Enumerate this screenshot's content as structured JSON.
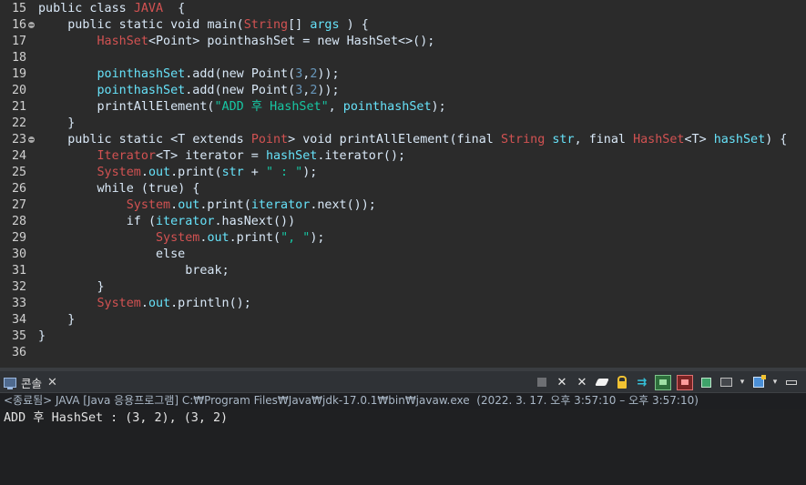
{
  "editor": {
    "lines": [
      {
        "n": "15",
        "fold": false,
        "segs": [
          [
            "kw",
            "public class "
          ],
          [
            "cls",
            "JAVA"
          ],
          [
            "pl",
            "  {"
          ]
        ]
      },
      {
        "n": "16",
        "fold": true,
        "segs": [
          [
            "pl",
            "    "
          ],
          [
            "kw",
            "public static void "
          ],
          [
            "pl",
            "main("
          ],
          [
            "cls",
            "String"
          ],
          [
            "pl",
            "[] "
          ],
          [
            "fld",
            "args"
          ],
          [
            "pl",
            " ) {"
          ]
        ]
      },
      {
        "n": "17",
        "fold": false,
        "segs": [
          [
            "pl",
            "        "
          ],
          [
            "cls",
            "HashSet"
          ],
          [
            "pl",
            "<Point> pointhashSet = "
          ],
          [
            "kw",
            "new "
          ],
          [
            "pl",
            "HashSet<>();"
          ]
        ]
      },
      {
        "n": "18",
        "fold": false,
        "segs": []
      },
      {
        "n": "19",
        "fold": false,
        "segs": [
          [
            "pl",
            "        "
          ],
          [
            "fld",
            "pointhashSet"
          ],
          [
            "pl",
            ".add("
          ],
          [
            "kw",
            "new "
          ],
          [
            "pl",
            "Point("
          ],
          [
            "num",
            "3"
          ],
          [
            "pl",
            ","
          ],
          [
            "num",
            "2"
          ],
          [
            "pl",
            "));"
          ]
        ]
      },
      {
        "n": "20",
        "fold": false,
        "segs": [
          [
            "pl",
            "        "
          ],
          [
            "fld",
            "pointhashSet"
          ],
          [
            "pl",
            ".add("
          ],
          [
            "kw",
            "new "
          ],
          [
            "pl",
            "Point("
          ],
          [
            "num",
            "3"
          ],
          [
            "pl",
            ","
          ],
          [
            "num",
            "2"
          ],
          [
            "pl",
            "));"
          ]
        ]
      },
      {
        "n": "21",
        "fold": false,
        "segs": [
          [
            "pl",
            "        printAllElement("
          ],
          [
            "str",
            "\"ADD 후 HashSet\""
          ],
          [
            "pl",
            ", "
          ],
          [
            "fld",
            "pointhashSet"
          ],
          [
            "pl",
            ");"
          ]
        ]
      },
      {
        "n": "22",
        "fold": false,
        "segs": [
          [
            "pl",
            "    }"
          ]
        ]
      },
      {
        "n": "23",
        "fold": true,
        "segs": [
          [
            "pl",
            "    "
          ],
          [
            "kw",
            "public static "
          ],
          [
            "pl",
            "<T "
          ],
          [
            "kw",
            "extends "
          ],
          [
            "cls",
            "Point"
          ],
          [
            "pl",
            "> "
          ],
          [
            "kw",
            "void "
          ],
          [
            "pl",
            "printAllElement("
          ],
          [
            "kw",
            "final "
          ],
          [
            "cls",
            "String"
          ],
          [
            "pl",
            " "
          ],
          [
            "fld",
            "str"
          ],
          [
            "pl",
            ", "
          ],
          [
            "kw",
            "final "
          ],
          [
            "cls",
            "HashSet"
          ],
          [
            "pl",
            "<T> "
          ],
          [
            "fld",
            "hashSet"
          ],
          [
            "pl",
            ") {"
          ]
        ]
      },
      {
        "n": "24",
        "fold": false,
        "segs": [
          [
            "pl",
            "        "
          ],
          [
            "cls",
            "Iterator"
          ],
          [
            "pl",
            "<T> iterator = "
          ],
          [
            "fld",
            "hashSet"
          ],
          [
            "pl",
            ".iterator();"
          ]
        ]
      },
      {
        "n": "25",
        "fold": false,
        "segs": [
          [
            "pl",
            "        "
          ],
          [
            "cls",
            "System"
          ],
          [
            "pl",
            "."
          ],
          [
            "fld",
            "out"
          ],
          [
            "pl",
            ".print("
          ],
          [
            "fld",
            "str"
          ],
          [
            "pl",
            " + "
          ],
          [
            "str",
            "\" : \""
          ],
          [
            "pl",
            ");"
          ]
        ]
      },
      {
        "n": "26",
        "fold": false,
        "segs": [
          [
            "pl",
            "        "
          ],
          [
            "kw",
            "while "
          ],
          [
            "pl",
            "("
          ],
          [
            "kw",
            "true"
          ],
          [
            "pl",
            ") {"
          ]
        ]
      },
      {
        "n": "27",
        "fold": false,
        "segs": [
          [
            "pl",
            "            "
          ],
          [
            "cls",
            "System"
          ],
          [
            "pl",
            "."
          ],
          [
            "fld",
            "out"
          ],
          [
            "pl",
            ".print("
          ],
          [
            "fld",
            "iterator"
          ],
          [
            "pl",
            ".next());"
          ]
        ]
      },
      {
        "n": "28",
        "fold": false,
        "segs": [
          [
            "pl",
            "            "
          ],
          [
            "kw",
            "if "
          ],
          [
            "pl",
            "("
          ],
          [
            "fld",
            "iterator"
          ],
          [
            "pl",
            ".hasNext())"
          ]
        ]
      },
      {
        "n": "29",
        "fold": false,
        "segs": [
          [
            "pl",
            "                "
          ],
          [
            "cls",
            "System"
          ],
          [
            "pl",
            "."
          ],
          [
            "fld",
            "out"
          ],
          [
            "pl",
            ".print("
          ],
          [
            "str",
            "\", \""
          ],
          [
            "pl",
            ");"
          ]
        ]
      },
      {
        "n": "30",
        "fold": false,
        "segs": [
          [
            "pl",
            "                "
          ],
          [
            "kw",
            "else"
          ]
        ]
      },
      {
        "n": "31",
        "fold": false,
        "segs": [
          [
            "pl",
            "                    "
          ],
          [
            "kw",
            "break"
          ],
          [
            "pl",
            ";"
          ]
        ]
      },
      {
        "n": "32",
        "fold": false,
        "segs": [
          [
            "pl",
            "        }"
          ]
        ]
      },
      {
        "n": "33",
        "fold": false,
        "segs": [
          [
            "pl",
            "        "
          ],
          [
            "cls",
            "System"
          ],
          [
            "pl",
            "."
          ],
          [
            "fld",
            "out"
          ],
          [
            "pl",
            ".println();"
          ]
        ]
      },
      {
        "n": "34",
        "fold": false,
        "segs": [
          [
            "pl",
            "    }"
          ]
        ]
      },
      {
        "n": "35",
        "fold": false,
        "segs": [
          [
            "pl",
            "}"
          ]
        ]
      },
      {
        "n": "36",
        "fold": false,
        "segs": []
      }
    ]
  },
  "console": {
    "tab_label": "콘솔",
    "tab_close": "✕",
    "toolbar_glyphs": {
      "x1": "✕",
      "x2": "✕",
      "wrap": "⇉",
      "dd": "▾"
    },
    "launch_info": "<종료됨> JAVA [Java 응용프로그램] C:₩Program Files₩Java₩jdk-17.0.1₩bin₩javaw.exe  (2022. 3. 17. 오후 3:57:10 – 오후 3:57:10)",
    "output": "ADD 후 HashSet : (3, 2), (3, 2)"
  },
  "colors": {
    "editor_bg": "#2b2b2b",
    "keyword": "#d9e8f7",
    "class": "#d25252",
    "field": "#66e1f8",
    "string": "#17c6a3",
    "number": "#6897bb"
  }
}
